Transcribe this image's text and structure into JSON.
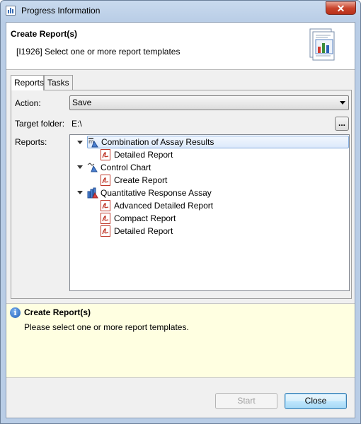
{
  "window": {
    "title": "Progress Information",
    "close_glyph": "✕"
  },
  "header": {
    "title": "Create Report(s)",
    "subtitle": "[I1926] Select one or more report templates",
    "icon": "report-chart-icon"
  },
  "tabs": [
    {
      "label": "Reports",
      "active": true
    },
    {
      "label": "Tasks",
      "active": false
    }
  ],
  "form": {
    "action_label": "Action:",
    "action_value": "Save",
    "target_folder_label": "Target folder:",
    "target_folder_value": "E:\\",
    "browse_label": "...",
    "reports_label": "Reports:"
  },
  "tree": {
    "groups": [
      {
        "label": "Combination of Assay Results",
        "icon": "combination-assay-icon",
        "selected": true,
        "children": [
          {
            "label": "Detailed Report",
            "icon": "pdf-icon"
          }
        ]
      },
      {
        "label": "Control Chart",
        "icon": "control-chart-icon",
        "selected": false,
        "children": [
          {
            "label": "Create Report",
            "icon": "pdf-icon"
          }
        ]
      },
      {
        "label": "Quantitative Response Assay",
        "icon": "quantitative-assay-icon",
        "selected": false,
        "children": [
          {
            "label": "Advanced Detailed Report",
            "icon": "pdf-icon"
          },
          {
            "label": "Compact Report",
            "icon": "pdf-icon"
          },
          {
            "label": "Detailed Report",
            "icon": "pdf-icon"
          }
        ]
      }
    ]
  },
  "status": {
    "icon": "info-icon",
    "icon_glyph": "i",
    "title": "Create Report(s)",
    "message": "Please select one or more report templates."
  },
  "buttons": {
    "start_label": "Start",
    "start_enabled": false,
    "close_label": "Close"
  },
  "colors": {
    "status_background": "#ffffe1",
    "selection_border": "#84acdd",
    "close_button": "#c9452d"
  }
}
